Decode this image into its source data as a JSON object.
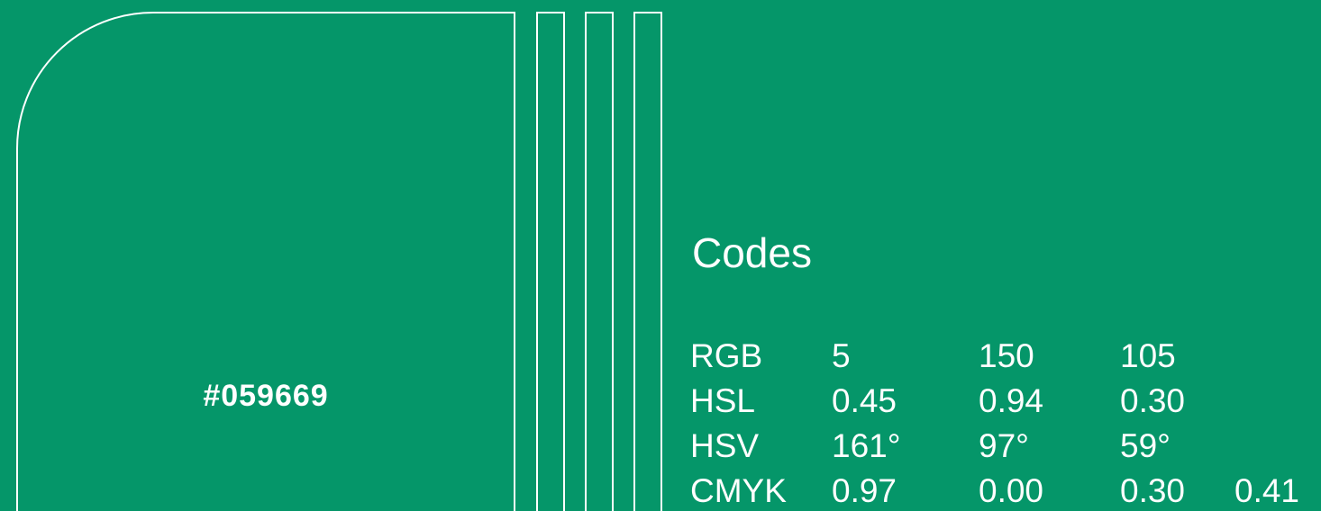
{
  "swatch": {
    "hex": "#059669",
    "color": "#059669"
  },
  "codes": {
    "title": "Codes",
    "rows": [
      {
        "label": "RGB",
        "values": [
          "5",
          "150",
          "105"
        ]
      },
      {
        "label": "HSL",
        "values": [
          "0.45",
          "0.94",
          "0.30"
        ]
      },
      {
        "label": "HSV",
        "values": [
          "161°",
          "97°",
          "59°"
        ]
      },
      {
        "label": "CMYK",
        "values": [
          "0.97",
          "0.00",
          "0.30",
          "0.41"
        ]
      }
    ]
  }
}
